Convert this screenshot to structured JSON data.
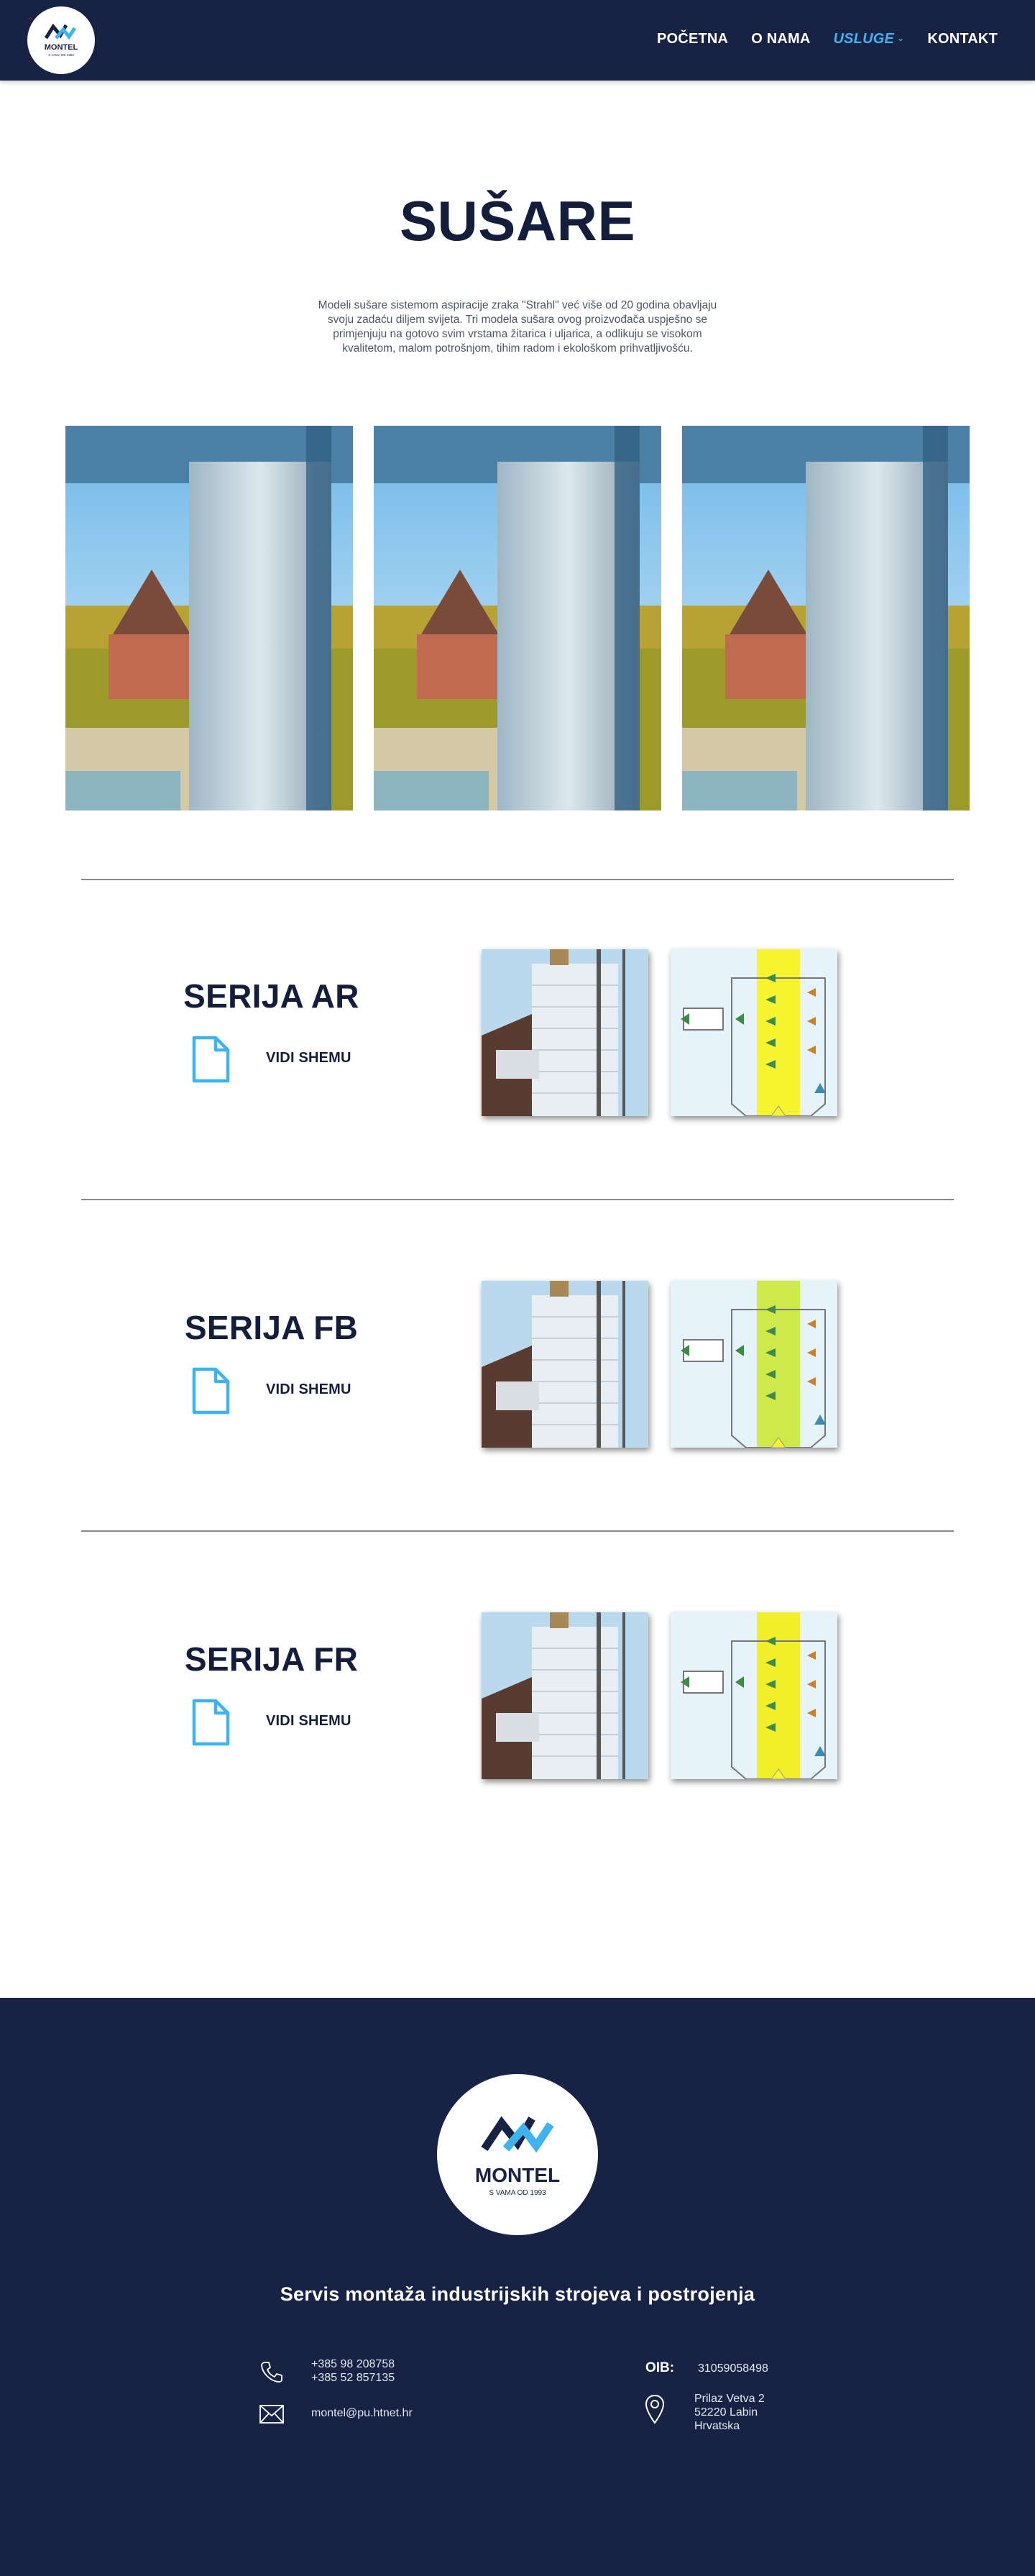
{
  "header": {
    "logo_alt": "MONTEL",
    "nav": [
      {
        "label": "POČETNA",
        "active": false
      },
      {
        "label": "O NAMA",
        "active": false
      },
      {
        "label": "USLUGE",
        "active": true,
        "has_dropdown": true
      },
      {
        "label": "KONTAKT",
        "active": false
      }
    ]
  },
  "hero": {
    "title": "SUŠARE",
    "intro": "Modeli sušare sistemom aspiracije zraka \"Strahl\" već više od 20 godina obavljaju svoju zadaću diljem svijeta. Tri modela sušara ovog proizvođača uspješno se primjenjuju na gotovo svim vrstama žitarica i uljarica, a odlikuju se visokom kvalitetom, malom potrošnjom, tihim radom i ekološkom prihvatljivošću."
  },
  "gallery": [
    {
      "icon": "grain-dryer-tower-photo"
    },
    {
      "icon": "grain-dryer-tower-photo"
    },
    {
      "icon": "grain-dryer-tower-photo"
    }
  ],
  "series": [
    {
      "title": "SERIJA AR",
      "link_label": "VIDI SHEMU",
      "icon": "document-icon",
      "scheme_color": "#f7f52f"
    },
    {
      "title": "SERIJA FB",
      "link_label": "VIDI SHEMU",
      "icon": "document-icon",
      "scheme_color": "#cfe84a"
    },
    {
      "title": "SERIJA FR",
      "link_label": "VIDI SHEMU",
      "icon": "document-icon",
      "scheme_color": "#f2ef2a"
    }
  ],
  "footer": {
    "logo_name": "MONTEL",
    "logo_subtitle": "S VAMA OD 1993",
    "tagline": "Servis montaža industrijskih strojeva i postrojenja",
    "phones": [
      "+385 98 208758",
      "+385 52 857135"
    ],
    "email": "montel@pu.htnet.hr",
    "oib_label": "OIB:",
    "oib": "31059058498",
    "address": [
      "Prilaz Vetva 2",
      "52220 Labin",
      "Hrvatska"
    ]
  },
  "colors": {
    "navy": "#172244",
    "accent": "#3fb3ef",
    "text_dark": "#141e3c"
  }
}
